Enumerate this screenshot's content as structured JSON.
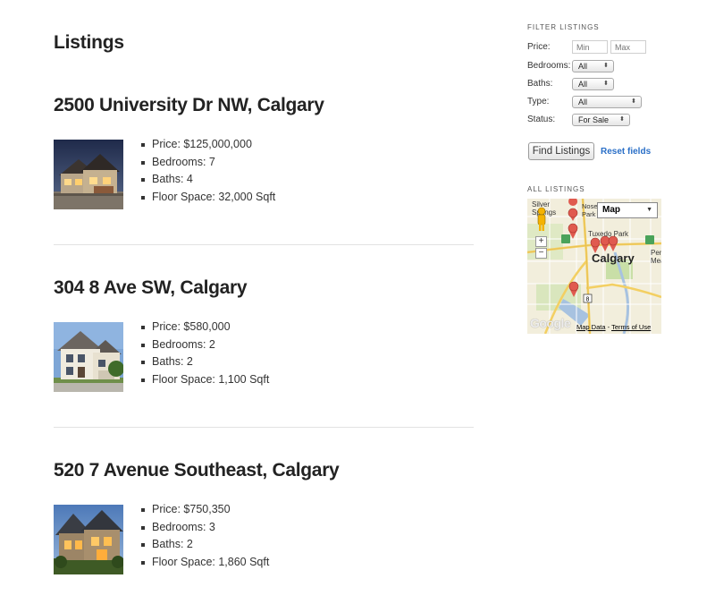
{
  "page": {
    "title": "Listings"
  },
  "listings": [
    {
      "title": "2500 University Dr NW, Calgary",
      "price": "Price: $125,000,000",
      "bedrooms": "Bedrooms: 7",
      "baths": "Baths: 4",
      "floor_space": "Floor Space: 32,000 Sqft"
    },
    {
      "title": "304 8 Ave SW, Calgary",
      "price": "Price: $580,000",
      "bedrooms": "Bedrooms: 2",
      "baths": "Baths: 2",
      "floor_space": "Floor Space: 1,100 Sqft"
    },
    {
      "title": "520 7 Avenue Southeast, Calgary",
      "price": "Price: $750,350",
      "bedrooms": "Bedrooms: 3",
      "baths": "Baths: 2",
      "floor_space": "Floor Space: 1,860 Sqft"
    }
  ],
  "filter": {
    "heading": "FILTER LISTINGS",
    "price_label": "Price:",
    "min_placeholder": "Min",
    "max_placeholder": "Max",
    "bedrooms_label": "Bedrooms:",
    "bedrooms_value": "All",
    "baths_label": "Baths:",
    "baths_value": "All",
    "type_label": "Type:",
    "type_value": "All",
    "status_label": "Status:",
    "status_value": "For Sale",
    "find_button": "Find Listings",
    "reset_link": "Reset fields"
  },
  "map": {
    "heading": "ALL LISTINGS",
    "map_type": "Map",
    "zoom_in": "+",
    "zoom_out": "−",
    "city_label": "Calgary",
    "area_labels": [
      "Silver Springs",
      "Nose Park",
      "Tuxedo Park",
      "Penbrooke Meadows"
    ],
    "marker_count": 6,
    "map_data_link": "Map Data",
    "separator": " - ",
    "terms_link": "Terms of Use",
    "logo": "Google",
    "route_shield": "8",
    "colors": {
      "land": "#f2eedc",
      "park": "#c9dfa7",
      "water": "#a7c2e0",
      "highway": "#f3cf62",
      "marker": "#e05a4f"
    }
  },
  "icons": {
    "bullet": "bullet-square-icon",
    "select_arrow": "updown-arrow-icon",
    "pegman": "pegman-icon",
    "marker": "map-marker-icon"
  },
  "colors": {
    "link": "#2a6fc7",
    "text": "#222222",
    "divider": "#e2e2e2"
  }
}
